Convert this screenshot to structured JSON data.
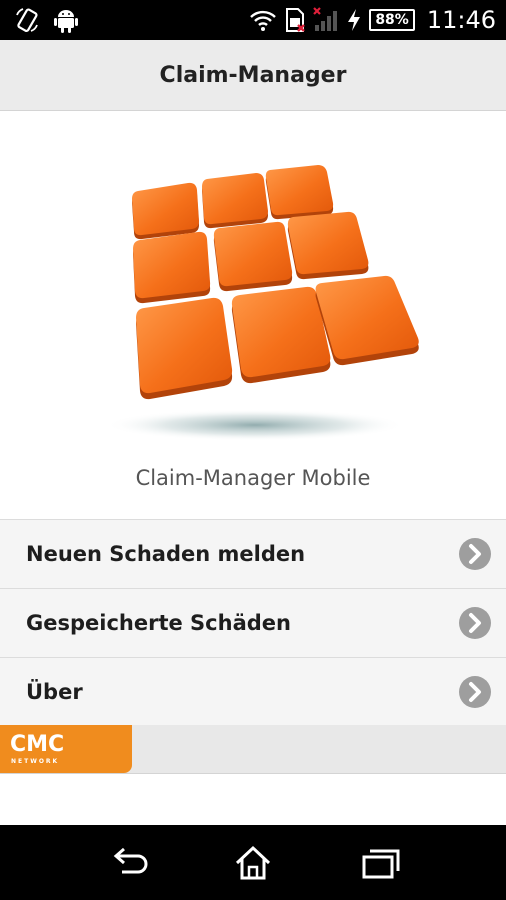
{
  "status_bar": {
    "battery_level": "88%",
    "time": "11:46",
    "icons": [
      "screen-rotation-icon",
      "android-icon",
      "wifi-icon",
      "sim-card-icon",
      "signal-icon",
      "charging-icon",
      "battery-icon"
    ]
  },
  "action_bar": {
    "title": "Claim-Manager"
  },
  "logo": {
    "tile_color": "#f26a12",
    "caption": "Claim-Manager Mobile"
  },
  "menu": {
    "items": [
      {
        "label": "Neuen Schaden melden",
        "icon": "chevron-right-icon"
      },
      {
        "label": "Gespeicherte Schäden",
        "icon": "chevron-right-icon"
      },
      {
        "label": "Über",
        "icon": "chevron-right-icon"
      }
    ]
  },
  "footer": {
    "brand": "CMC",
    "brand_sub": "NETWORK",
    "brand_color": "#f08c1e"
  },
  "nav_bar": {
    "buttons": [
      "back-icon",
      "home-icon",
      "recent-apps-icon"
    ]
  }
}
